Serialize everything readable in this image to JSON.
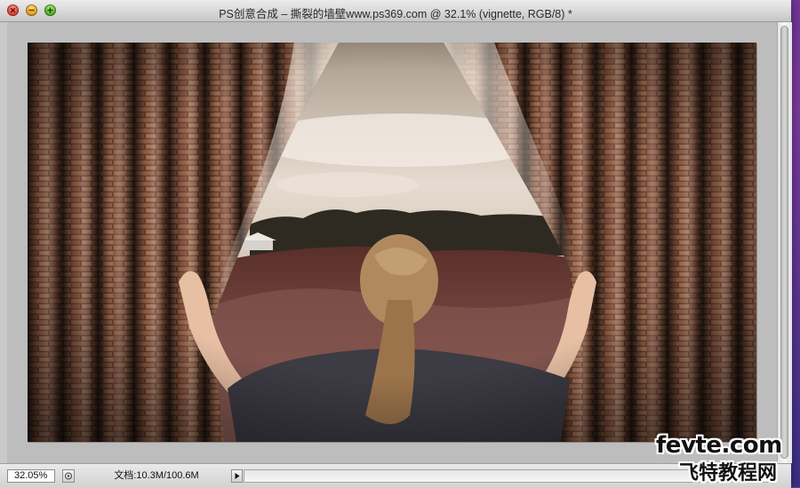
{
  "window": {
    "title": "PS创意合成 – 撕裂的墙壁www.ps369.com @ 32.1% (vignette, RGB/8) *"
  },
  "statusbar": {
    "zoom": "32.05%",
    "doc_info": "文档:10.3M/100.6M"
  },
  "watermark": {
    "line1": "fevte.com",
    "line2": "飞特教程网"
  },
  "canvas": {
    "description_icon": "photo-canvas",
    "colors": {
      "sky": "#d8c9bb",
      "brick": "#7a4a34",
      "field": "#6b3f36",
      "shirt": "#3d3b44",
      "hair": "#b08a5e"
    }
  }
}
